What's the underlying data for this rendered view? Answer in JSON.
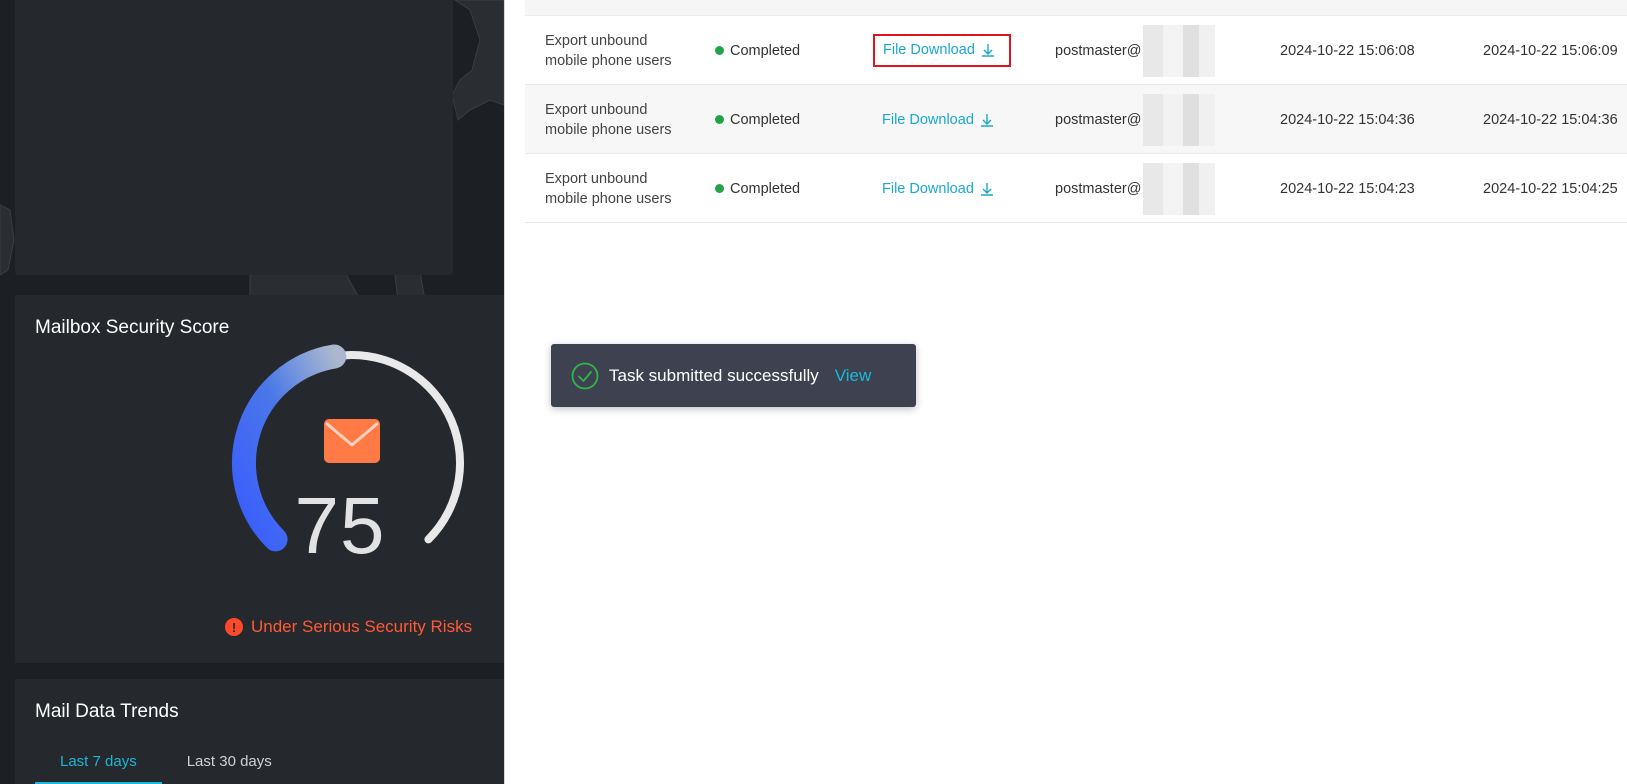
{
  "dashboard": {
    "security_score": {
      "title": "Mailbox Security Score",
      "score": "75",
      "score_value": 75,
      "risk_text": "Under Serious Security Risks",
      "colors": {
        "arc_start": "#3a66ff",
        "arc_end": "#9fb1cf",
        "risk": "#ff5a36",
        "mail_icon": "#ff7a45"
      }
    },
    "mail_trends": {
      "title": "Mail Data Trends",
      "tabs": [
        {
          "label": "Last 7 days",
          "active": true
        },
        {
          "label": "Last 30 days",
          "active": false
        }
      ]
    }
  },
  "tasks": {
    "rows": [
      {
        "task": "Export unbound mobile phone users",
        "status": "Completed",
        "action": "File Download",
        "owner": "postmaster@",
        "created": "2024-10-22 15:06:08",
        "finished": "2024-10-22 15:06:09"
      },
      {
        "task": "Export unbound mobile phone users",
        "status": "Completed",
        "action": "File Download",
        "owner": "postmaster@",
        "created": "2024-10-22 15:04:36",
        "finished": "2024-10-22 15:04:36"
      },
      {
        "task": "Export unbound mobile phone users",
        "status": "Completed",
        "action": "File Download",
        "owner": "postmaster@",
        "created": "2024-10-22 15:04:23",
        "finished": "2024-10-22 15:04:25"
      }
    ],
    "status_color": "#22a34a",
    "link_color": "#19a8d4"
  },
  "toast": {
    "message": "Task submitted successfully",
    "link": "View"
  }
}
